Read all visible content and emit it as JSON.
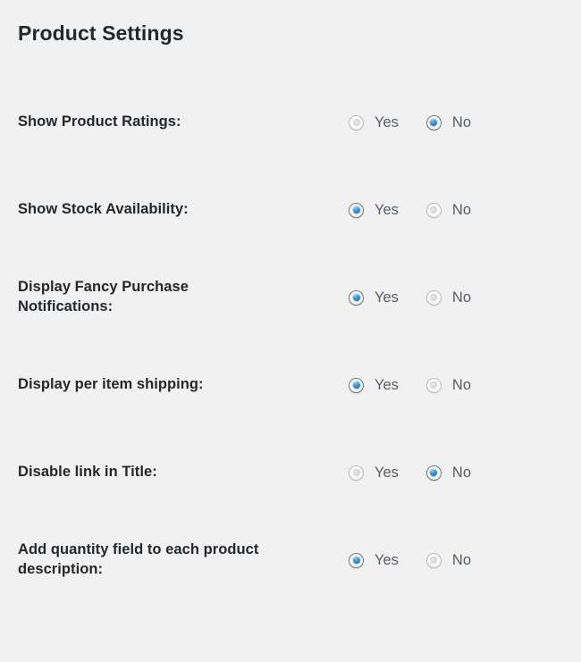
{
  "page": {
    "title": "Product Settings",
    "background_color": "#f1f1f1",
    "label_color": "#23282d",
    "option_text_color": "#555d66",
    "accent_color": "#2e93d1"
  },
  "options": {
    "yes_label": "Yes",
    "no_label": "No"
  },
  "settings": [
    {
      "label": "Show Product Ratings:",
      "yes_label": "Yes",
      "no_label": "No",
      "value": "No"
    },
    {
      "label": "Show Stock Availability:",
      "yes_label": "Yes",
      "no_label": "No",
      "value": "Yes"
    },
    {
      "label": "Display Fancy Purchase Notifications:",
      "yes_label": "Yes",
      "no_label": "No",
      "value": "Yes"
    },
    {
      "label": "Display per item shipping:",
      "yes_label": "Yes",
      "no_label": "No",
      "value": "Yes"
    },
    {
      "label": "Disable link in Title:",
      "yes_label": "Yes",
      "no_label": "No",
      "value": "No"
    },
    {
      "label": "Add quantity field to each product description:",
      "yes_label": "Yes",
      "no_label": "No",
      "value": "Yes"
    }
  ]
}
